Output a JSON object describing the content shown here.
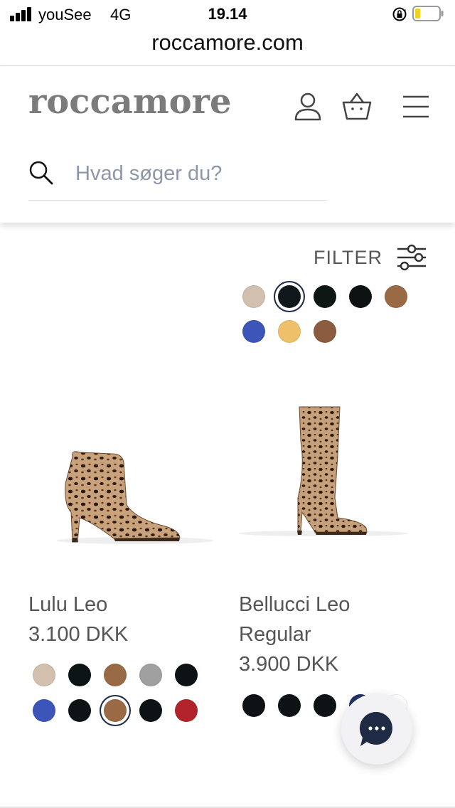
{
  "status_bar": {
    "carrier": "youSee",
    "network": "4G",
    "time": "19.14"
  },
  "browser": {
    "url": "roccamore.com"
  },
  "header": {
    "logo": "roccamore",
    "search_placeholder": "Hvad søger du?",
    "search_value": ""
  },
  "filter": {
    "label": "FILTER"
  },
  "top_swatches": {
    "row1": [
      "#d3bfae",
      "#10181c",
      "#0f1714",
      "#0d1312",
      "#9a6a45"
    ],
    "row2": [
      "#3d55b8",
      "#eec06a",
      "#8b5c3d"
    ],
    "selected_index_row1": 1
  },
  "products": [
    {
      "name": "Lulu Leo",
      "price": "3.100 DKK",
      "swatches": [
        "#d3bfae",
        "#0d1416",
        "#9a6a45",
        "#a0a0a0",
        "#0d1214",
        "#3d55b8",
        "#0e1416",
        "#9a6a45",
        "#0d1214",
        "#b3232b"
      ],
      "selected_swatch": 7
    },
    {
      "name": "Bellucci Leo",
      "name_line2": "Regular",
      "price": "3.900 DKK",
      "swatches": [
        "#0d1214",
        "#0d1214",
        "#0d1214",
        "#223366",
        "#ffffff"
      ]
    }
  ],
  "colors": {
    "text_gray": "#555555",
    "logo_gray": "#7b7b7b",
    "chat_navy": "#1f2a44",
    "placeholder": "#8c97a8"
  },
  "icons": [
    "signal-icon",
    "lock-rotation-icon",
    "battery-icon",
    "user-icon",
    "basket-icon",
    "menu-icon",
    "search-icon",
    "filter-sliders-icon",
    "chat-icon"
  ]
}
